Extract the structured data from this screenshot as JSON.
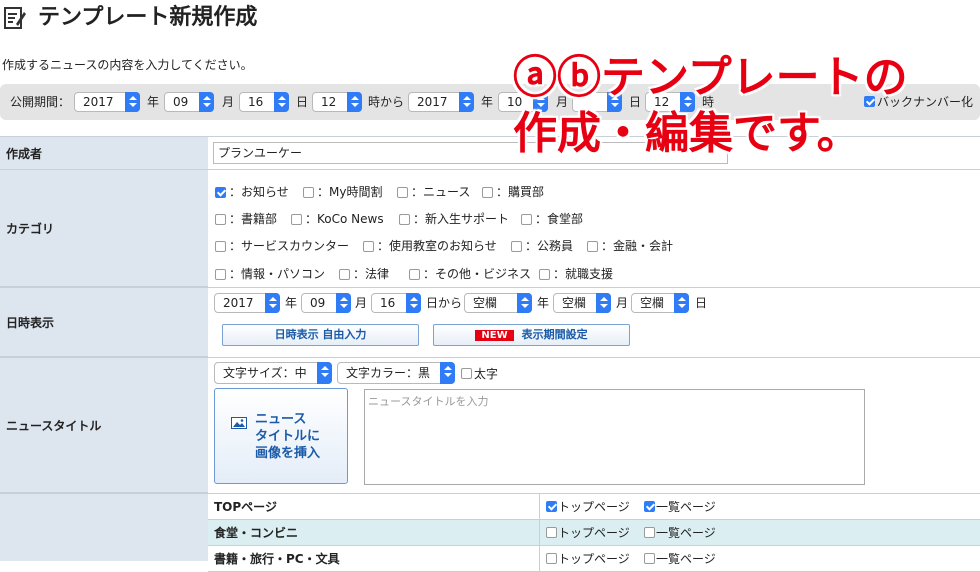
{
  "header": {
    "title": "テンプレート新規作成",
    "description": "作成するニュースの内容を入力してください。"
  },
  "period_bar": {
    "label": "公開期間：",
    "start_year": "2017",
    "year_unit": "年",
    "start_month": "09",
    "month_unit": "月",
    "start_day": "16",
    "day_unit": "日",
    "start_hour": "12",
    "hour_unit": "時から",
    "end_year": "2017",
    "end_year_unit": "年",
    "end_month": "10",
    "end_month_unit": "月",
    "end_day_unit": "日",
    "end_hour": "12",
    "end_hour_unit": "時",
    "backnumber_label": "バックナンバー化"
  },
  "overlay": {
    "line1": "ⓐⓑテンプレートの",
    "line2": "作成・編集です。"
  },
  "author": {
    "label": "作成者",
    "value": "プランユーケー"
  },
  "category": {
    "label": "カテゴリ",
    "items": [
      {
        "label": "：お知らせ",
        "checked": true
      },
      {
        "label": "：My時間割",
        "checked": false
      },
      {
        "label": "：ニュース",
        "checked": false
      },
      {
        "label": "：購買部",
        "checked": false
      },
      {
        "label": "：書籍部",
        "checked": false
      },
      {
        "label": "：KoCo News",
        "checked": false
      },
      {
        "label": "：新入生サポート",
        "checked": false
      },
      {
        "label": "：食堂部",
        "checked": false
      },
      {
        "label": "：サービスカウンター",
        "checked": false
      },
      {
        "label": "：使用教室のお知らせ",
        "checked": false
      },
      {
        "label": "：公務員",
        "checked": false
      },
      {
        "label": "：金融・会計",
        "checked": false
      },
      {
        "label": "：情報・パソコン",
        "checked": false
      },
      {
        "label": "：法律",
        "checked": false
      },
      {
        "label": "：その他・ビジネス",
        "checked": false
      },
      {
        "label": "：就職支援",
        "checked": false
      }
    ]
  },
  "datetime": {
    "label": "日時表示",
    "year": "2017",
    "year_unit": "年",
    "month": "09",
    "month_unit": "月",
    "day": "16",
    "day_unit": "日から",
    "blank1": "空欄",
    "year2_unit": "年",
    "blank2": "空欄",
    "month2_unit": "月",
    "blank3": "空欄",
    "day2_unit": "日",
    "free_input_button": "日時表示 自由入力",
    "new_tag": "NEW",
    "period_setting_button": "表示期間設定"
  },
  "news_title": {
    "label": "ニュースタイトル",
    "font_size_select": "文字サイズ：中",
    "font_color_select": "文字カラー：黒",
    "bold_label": "太字",
    "insert_image_button": "ニュースタイトルに画像を挿入",
    "insert_image_line1": "ニュース",
    "insert_image_line2": "タイトルに",
    "insert_image_line3": "画像を挿入",
    "placeholder": "ニュースタイトルを入力"
  },
  "pages": {
    "rows": [
      {
        "name": "TOPページ",
        "top_label": "トップページ",
        "top_checked": true,
        "list_label": "一覧ページ",
        "list_checked": true
      },
      {
        "name": "食堂・コンビニ",
        "top_label": "トップページ",
        "top_checked": false,
        "list_label": "一覧ページ",
        "list_checked": false
      },
      {
        "name": "書籍・旅行・PC・文具",
        "top_label": "トップページ",
        "top_checked": false,
        "list_label": "一覧ページ",
        "list_checked": false
      }
    ]
  },
  "colors": {
    "accent": "#2f7cf6",
    "label_bg": "#dde6ef",
    "overlay_red": "#e60012",
    "highlight_row": "#dbeef1"
  }
}
